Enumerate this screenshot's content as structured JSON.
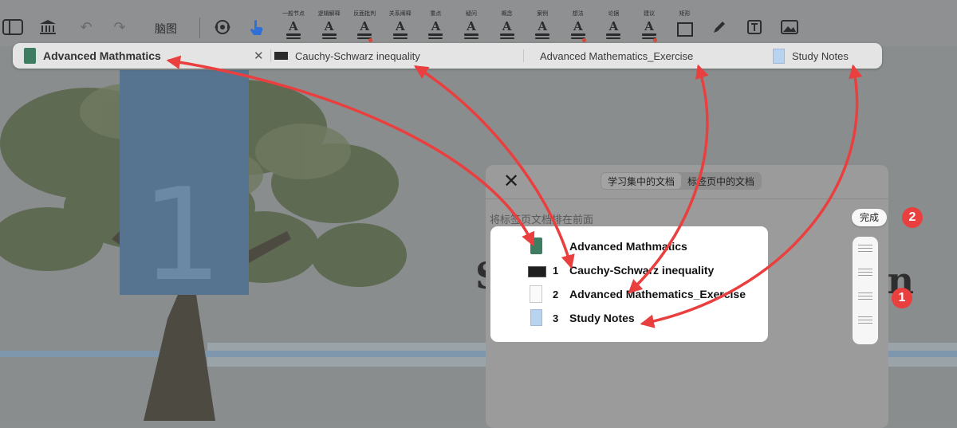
{
  "toolbar": {
    "mindmap_label": "脑图",
    "highlighters": [
      {
        "label": "一般节点",
        "glyph": "A",
        "dot": false
      },
      {
        "label": "逻辑解释",
        "glyph": "A",
        "dot": false
      },
      {
        "label": "反面批判",
        "glyph": "A",
        "dot": true
      },
      {
        "label": "关系阐释",
        "glyph": "A",
        "dot": false
      },
      {
        "label": "重点",
        "glyph": "A",
        "dot": false
      },
      {
        "label": "疑问",
        "glyph": "A",
        "dot": false
      },
      {
        "label": "概念",
        "glyph": "A",
        "dot": false
      },
      {
        "label": "案例",
        "glyph": "A",
        "dot": false
      },
      {
        "label": "想法",
        "glyph": "A",
        "dot": true
      },
      {
        "label": "论据",
        "glyph": "A",
        "dot": false
      },
      {
        "label": "建议",
        "glyph": "A",
        "dot": true
      },
      {
        "label": "矩形",
        "glyph": "",
        "dot": false
      }
    ]
  },
  "tabs": [
    {
      "label": "Advanced Mathmatics",
      "active": true
    },
    {
      "label": "Cauchy-Schwarz inequality",
      "active": false
    },
    {
      "label": "Advanced Mathematics_Exercise",
      "active": false
    },
    {
      "label": "Study Notes",
      "active": false
    }
  ],
  "background": {
    "page_number": "1",
    "heading_fragment": "s on"
  },
  "modal": {
    "segments": [
      "学习集中的文档",
      "标签页中的文档"
    ],
    "hint": "将标签页文档排在前面",
    "done_label": "完成",
    "items": [
      {
        "num": "",
        "title": "Advanced Mathmatics"
      },
      {
        "num": "1",
        "title": "Cauchy-Schwarz inequality"
      },
      {
        "num": "2",
        "title": "Advanced Mathematics_Exercise"
      },
      {
        "num": "3",
        "title": "Study Notes"
      }
    ]
  },
  "badges": [
    "1",
    "2"
  ],
  "colors": {
    "annotation": "#ea3f3f",
    "accent": "#3b82f6",
    "card": "#ffffff",
    "overlay": "#8b8e8f"
  }
}
